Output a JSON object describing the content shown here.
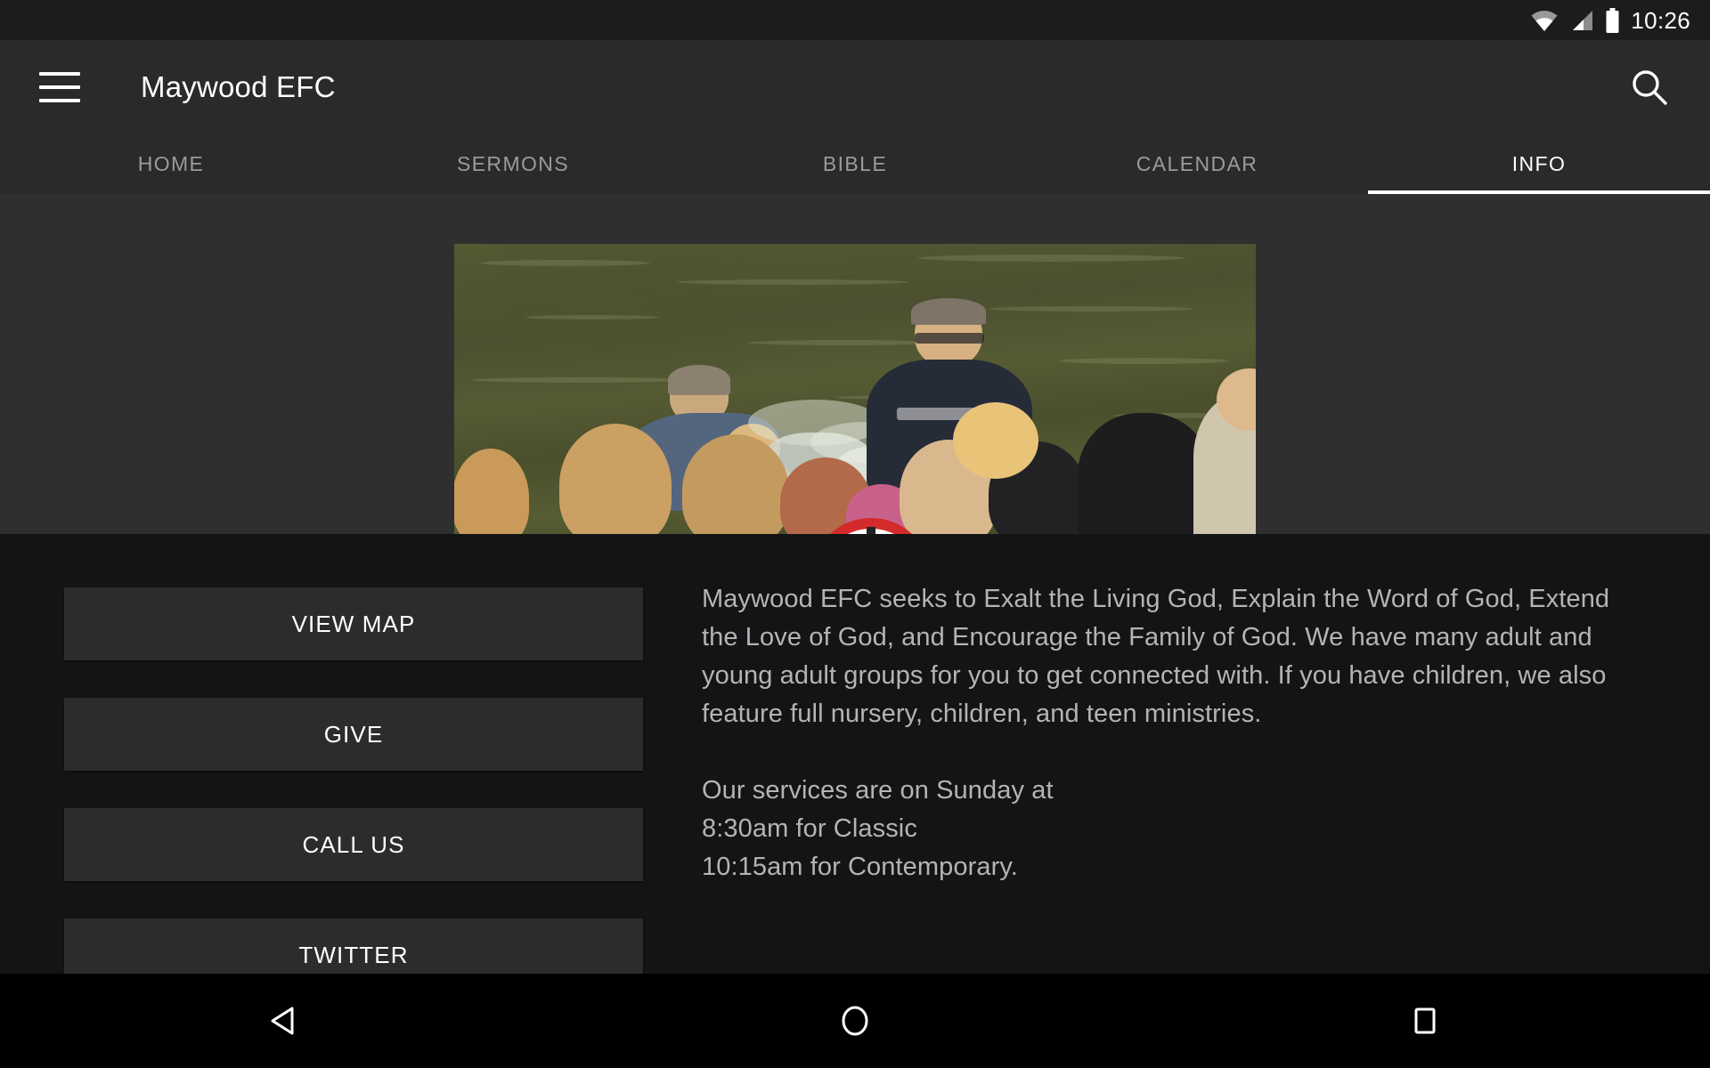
{
  "status_bar": {
    "time": "10:26",
    "icons": [
      "wifi-icon",
      "signal-icon",
      "battery-icon"
    ]
  },
  "app_bar": {
    "menu_icon": "hamburger-menu-icon",
    "title": "Maywood EFC",
    "search_icon": "search-icon"
  },
  "tabs": [
    {
      "label": "HOME",
      "active": false
    },
    {
      "label": "SERMONS",
      "active": false
    },
    {
      "label": "BIBLE",
      "active": false
    },
    {
      "label": "CALENDAR",
      "active": false
    },
    {
      "label": "INFO",
      "active": true
    }
  ],
  "hero": {
    "image_description": "Outdoor baptism in a pond with onlookers",
    "logo_description": "Church logo: red circle with cross over an open book"
  },
  "buttons": [
    {
      "label": "VIEW MAP"
    },
    {
      "label": "GIVE"
    },
    {
      "label": "CALL US"
    },
    {
      "label": "TWITTER"
    }
  ],
  "info": {
    "paragraph1": "Maywood EFC seeks to Exalt the Living God, Explain the Word of God, Extend the Love of God, and Encourage the Family of God. We have many adult and young adult groups for you to get connected with. If you have children, we also feature full nursery, children, and teen ministries.",
    "paragraph2": "Our services are on Sunday at\n8:30am for Classic\n10:15am for Contemporary."
  },
  "nav_bar": {
    "back": "back-triangle-icon",
    "home": "home-circle-icon",
    "recents": "recents-square-icon"
  },
  "colors": {
    "app_bar_bg": "#2a2a2a",
    "content_bg": "#121416",
    "button_bg": "#2c2c2c",
    "active_tab": "#ffffff",
    "inactive_tab": "#9b9b9b",
    "body_text": "#b4b4b4",
    "logo_red": "#d32b2b"
  }
}
